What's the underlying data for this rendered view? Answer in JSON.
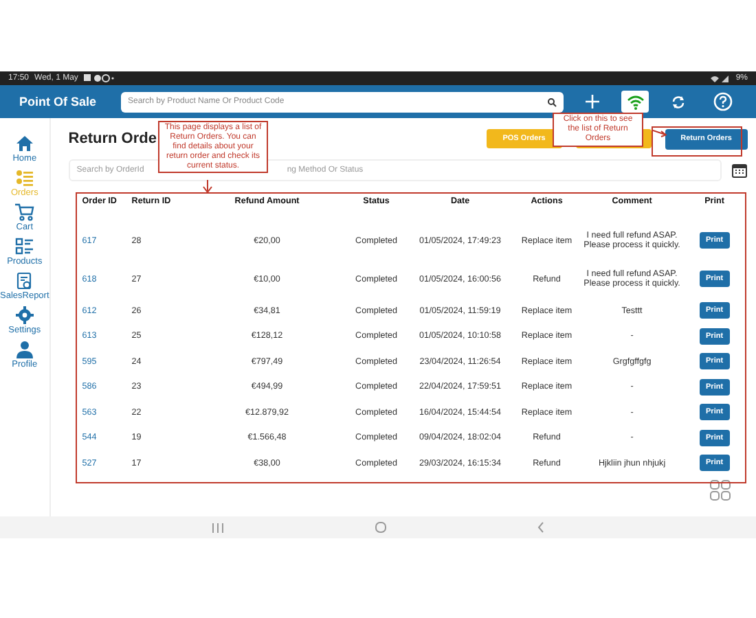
{
  "status_bar": {
    "time": "17:50",
    "date": "Wed, 1 May",
    "battery": "9%"
  },
  "header": {
    "title": "Point Of Sale",
    "search": {
      "placeholder": "Search by Product Name Or Product Code"
    }
  },
  "sidebar": {
    "items": [
      {
        "label": "Home",
        "selected": false
      },
      {
        "label": "Orders",
        "selected": true
      },
      {
        "label": "Cart",
        "selected": false
      },
      {
        "label": "Products",
        "selected": false
      },
      {
        "label": "SalesReport",
        "selected": false
      },
      {
        "label": "Settings",
        "selected": false
      },
      {
        "label": "Profile",
        "selected": false
      }
    ]
  },
  "page": {
    "title": "Return Orde",
    "order_buttons": [
      {
        "label": "POS Orders",
        "selected": false
      },
      {
        "selected": false
      },
      {
        "label": "Return Orders",
        "selected": true
      }
    ],
    "filter": {
      "placeholder_start": "Search by OrderId",
      "placeholder_end": "ng Method Or Status"
    }
  },
  "table": {
    "columns": [
      "Order ID",
      "Return ID",
      "Refund Amount",
      "Status",
      "Date",
      "Actions",
      "Comment",
      "Print"
    ],
    "rows": [
      {
        "order_id": "617",
        "return_id": "28",
        "refund": "€20,00",
        "status": "Completed",
        "date": "01/05/2024, 17:49:23",
        "action": "Replace item",
        "comment": "I need full refund ASAP. Please process it quickly.",
        "print": "Print"
      },
      {
        "order_id": "618",
        "return_id": "27",
        "refund": "€10,00",
        "status": "Completed",
        "date": "01/05/2024, 16:00:56",
        "action": "Refund",
        "comment": "I need full refund ASAP. Please process it quickly.",
        "print": "Print"
      },
      {
        "order_id": "612",
        "return_id": "26",
        "refund": "€34,81",
        "status": "Completed",
        "date": "01/05/2024, 11:59:19",
        "action": "Replace item",
        "comment": "Testtt",
        "print": "Print"
      },
      {
        "order_id": "613",
        "return_id": "25",
        "refund": "€128,12",
        "status": "Completed",
        "date": "01/05/2024, 10:10:58",
        "action": "Replace item",
        "comment": "-",
        "print": "Print"
      },
      {
        "order_id": "595",
        "return_id": "24",
        "refund": "€797,49",
        "status": "Completed",
        "date": "23/04/2024, 11:26:54",
        "action": "Replace item",
        "comment": "Grgfgffgfg",
        "print": "Print"
      },
      {
        "order_id": "586",
        "return_id": "23",
        "refund": "€494,99",
        "status": "Completed",
        "date": "22/04/2024, 17:59:51",
        "action": "Replace item",
        "comment": "-",
        "print": "Print"
      },
      {
        "order_id": "563",
        "return_id": "22",
        "refund": "€12.879,92",
        "status": "Completed",
        "date": "16/04/2024, 15:44:54",
        "action": "Replace item",
        "comment": "-",
        "print": "Print"
      },
      {
        "order_id": "544",
        "return_id": "19",
        "refund": "€1.566,48",
        "status": "Completed",
        "date": "09/04/2024, 18:02:04",
        "action": "Refund",
        "comment": "-",
        "print": "Print"
      },
      {
        "order_id": "527",
        "return_id": "17",
        "refund": "€38,00",
        "status": "Completed",
        "date": "29/03/2024, 16:15:34",
        "action": "Refund",
        "comment": "Hjkliin jhun nhjukj",
        "print": "Print"
      }
    ]
  },
  "annotations": [
    {
      "text": "This page displays a list of Return Orders. You can find details about your return order and check its current status."
    },
    {
      "text": "Click on this to see the list of Return Orders"
    }
  ]
}
